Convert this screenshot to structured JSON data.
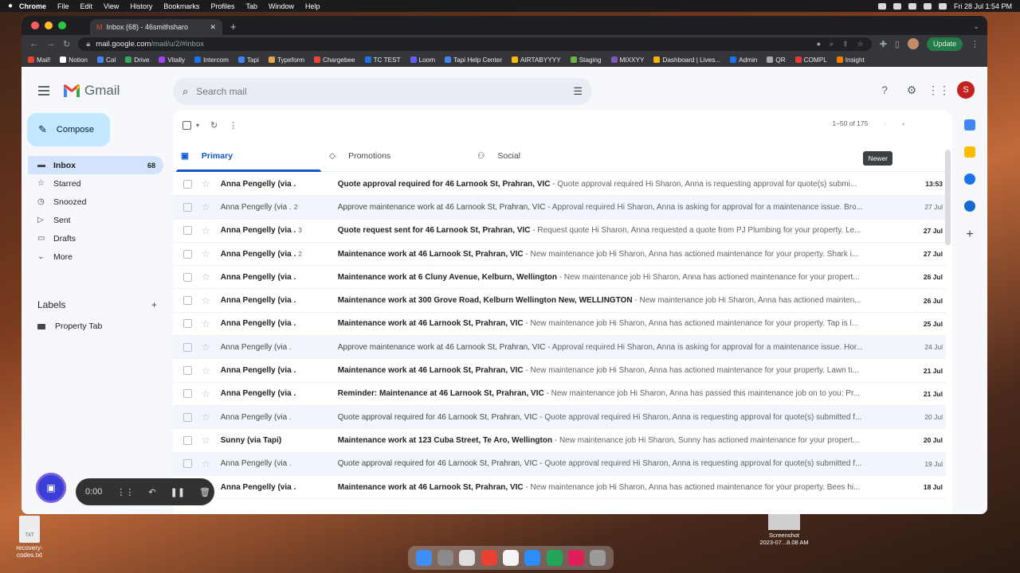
{
  "menubar": {
    "app": "Chrome",
    "items": [
      "File",
      "Edit",
      "View",
      "History",
      "Bookmarks",
      "Profiles",
      "Tab",
      "Window",
      "Help"
    ],
    "clock": "Fri 28 Jul  1:54 PM"
  },
  "browser": {
    "tab_title": "Inbox (68) - 46smithsharo",
    "url_host": "mail.google.com",
    "url_path": "/mail/u/2/#inbox",
    "update_label": "Update",
    "bookmarks": [
      "Mail!",
      "Notion",
      "Cal",
      "Drive",
      "Vitally",
      "Intercom",
      "Tapi",
      "Typeform",
      "Chargebee",
      "TC TEST",
      "Loom",
      "Tapi Help Center",
      "AIRTABYYYY",
      "Staging",
      "MIXXYY",
      "Dashboard | Lives...",
      "Admin",
      "QR",
      "COMPL",
      "Insight"
    ]
  },
  "gmail": {
    "logo_text": "Gmail",
    "search_placeholder": "Search mail",
    "profile_initial": "S",
    "compose_label": "Compose",
    "nav": [
      {
        "label": "Inbox",
        "count": "68"
      },
      {
        "label": "Starred",
        "count": ""
      },
      {
        "label": "Snoozed",
        "count": ""
      },
      {
        "label": "Sent",
        "count": ""
      },
      {
        "label": "Drafts",
        "count": ""
      },
      {
        "label": "More",
        "count": ""
      }
    ],
    "labels_header": "Labels",
    "labels": [
      "Property Tab"
    ],
    "pager": "1–50 of 175",
    "tooltip": "Newer",
    "tabs": [
      "Primary",
      "Promotions",
      "Social"
    ]
  },
  "emails": [
    {
      "from": "Anna Pengelly (via .",
      "count": "",
      "subject": "Quote approval required for 46 Larnook St, Prahran, VIC",
      "snippet": " - Quote approval required Hi Sharon, Anna is requesting approval for quote(s) submi...",
      "date": "13:53",
      "unread": true
    },
    {
      "from": "Anna Pengelly (via .",
      "count": "2",
      "subject": "Approve maintenance work at 46 Larnook St, Prahran, VIC",
      "snippet": " - Approval required Hi Sharon, Anna is asking for approval for a maintenance issue. Bro...",
      "date": "27 Jul",
      "unread": false
    },
    {
      "from": "Anna Pengelly (via .",
      "count": "3",
      "subject": "Quote request sent for 46 Larnook St, Prahran, VIC",
      "snippet": " - Request quote Hi Sharon, Anna requested a quote from PJ Plumbing for your property. Le...",
      "date": "27 Jul",
      "unread": true
    },
    {
      "from": "Anna Pengelly (via .",
      "count": "2",
      "subject": "Maintenance work at 46 Larnook St, Prahran, VIC",
      "snippet": " - New maintenance job Hi Sharon, Anna has actioned maintenance for your property. Shark i...",
      "date": "27 Jul",
      "unread": true
    },
    {
      "from": "Anna Pengelly (via .",
      "count": "",
      "subject": "Maintenance work at 6 Cluny Avenue, Kelburn, Wellington",
      "snippet": " - New maintenance job Hi Sharon, Anna has actioned maintenance for your propert...",
      "date": "26 Jul",
      "unread": true
    },
    {
      "from": "Anna Pengelly (via .",
      "count": "",
      "subject": "Maintenance work at 300 Grove Road, Kelburn Wellington New, WELLINGTON",
      "snippet": " - New maintenance job Hi Sharon, Anna has actioned mainten...",
      "date": "26 Jul",
      "unread": true
    },
    {
      "from": "Anna Pengelly (via .",
      "count": "",
      "subject": "Maintenance work at 46 Larnook St, Prahran, VIC",
      "snippet": " - New maintenance job Hi Sharon, Anna has actioned maintenance for your property. Tap is l...",
      "date": "25 Jul",
      "unread": true
    },
    {
      "from": "Anna Pengelly (via .",
      "count": "",
      "subject": "Approve maintenance work at 46 Larnook St, Prahran, VIC",
      "snippet": " - Approval required Hi Sharon, Anna is asking for approval for a maintenance issue. Hor...",
      "date": "24 Jul",
      "unread": false
    },
    {
      "from": "Anna Pengelly (via .",
      "count": "",
      "subject": "Maintenance work at 46 Larnook St, Prahran, VIC",
      "snippet": " - New maintenance job Hi Sharon, Anna has actioned maintenance for your property. Lawn ti...",
      "date": "21 Jul",
      "unread": true
    },
    {
      "from": "Anna Pengelly (via .",
      "count": "",
      "subject": "Reminder: Maintenance at 46 Larnook St, Prahran, VIC",
      "snippet": " - New maintenance job Hi Sharon, Anna has passed this maintenance job on to you: Pr...",
      "date": "21 Jul",
      "unread": true
    },
    {
      "from": "Anna Pengelly (via .",
      "count": "",
      "subject": "Quote approval required for 46 Larnook St, Prahran, VIC",
      "snippet": " - Quote approval required Hi Sharon, Anna is requesting approval for quote(s) submitted f...",
      "date": "20 Jul",
      "unread": false
    },
    {
      "from": "Sunny (via Tapi)",
      "count": "",
      "subject": "Maintenance work at 123 Cuba Street, Te Aro, Wellington",
      "snippet": " - New maintenance job Hi Sharon, Sunny has actioned maintenance for your propert...",
      "date": "20 Jul",
      "unread": true
    },
    {
      "from": "Anna Pengelly (via .",
      "count": "",
      "subject": "Quote approval required for 46 Larnook St, Prahran, VIC",
      "snippet": " - Quote approval required Hi Sharon, Anna is requesting approval for quote(s) submitted f...",
      "date": "19 Jul",
      "unread": false
    },
    {
      "from": "Anna Pengelly (via .",
      "count": "",
      "subject": "Maintenance work at 46 Larnook St, Prahran, VIC",
      "snippet": " - New maintenance job Hi Sharon, Anna has actioned maintenance for your property. Bees hi...",
      "date": "18 Jul",
      "unread": true
    }
  ],
  "recorder": {
    "time": "0:00"
  },
  "desktop": {
    "file_label": "recovery-codes.txt",
    "file_ext": "TXT",
    "screenshot_label": "Screenshot",
    "screenshot_date": "2023-07...8.08 AM"
  }
}
